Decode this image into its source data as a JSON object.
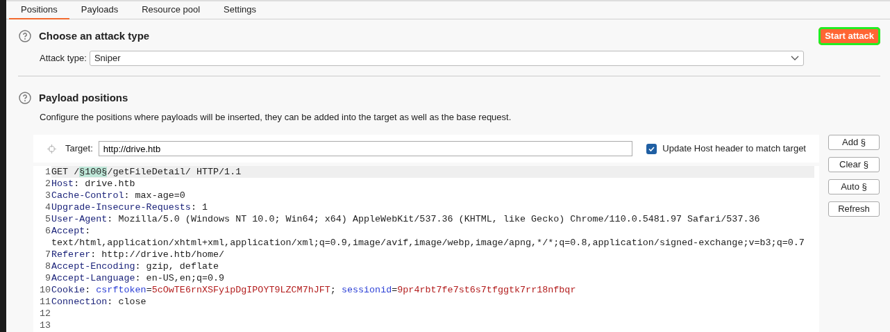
{
  "tabs": [
    {
      "label": "Positions",
      "selected": true
    },
    {
      "label": "Payloads",
      "selected": false
    },
    {
      "label": "Resource pool",
      "selected": false
    },
    {
      "label": "Settings",
      "selected": false
    }
  ],
  "attack_section": {
    "title": "Choose an attack type",
    "attack_type_label": "Attack type:",
    "attack_type_value": "Sniper"
  },
  "start_button": {
    "label": "Start attack",
    "highlighted": true
  },
  "positions_section": {
    "title": "Payload positions",
    "description": "Configure the positions where payloads will be inserted, they can be added into the target as well as the base request.",
    "target_label": "Target:",
    "target_value": "http://drive.htb",
    "update_host": {
      "label": "Update Host header to match target",
      "checked": true
    },
    "request_lines": [
      {
        "number": "1",
        "current": true,
        "segments": [
          {
            "kind": "plain",
            "text": "GET /"
          },
          {
            "kind": "marker",
            "text": "§100§"
          },
          {
            "kind": "plain",
            "text": "/getFileDetail/ HTTP/1.1"
          }
        ]
      },
      {
        "number": "2",
        "current": false,
        "segments": [
          {
            "kind": "header",
            "text": "Host"
          },
          {
            "kind": "plain",
            "text": ": drive.htb"
          }
        ]
      },
      {
        "number": "3",
        "current": false,
        "segments": [
          {
            "kind": "header",
            "text": "Cache-Control"
          },
          {
            "kind": "plain",
            "text": ": max-age=0"
          }
        ]
      },
      {
        "number": "4",
        "current": false,
        "segments": [
          {
            "kind": "header",
            "text": "Upgrade-Insecure-Requests"
          },
          {
            "kind": "plain",
            "text": ": 1"
          }
        ]
      },
      {
        "number": "5",
        "current": false,
        "segments": [
          {
            "kind": "header",
            "text": "User-Agent"
          },
          {
            "kind": "plain",
            "text": ": Mozilla/5.0 (Windows NT 10.0; Win64; x64) AppleWebKit/537.36 (KHTML, like Gecko) Chrome/110.0.5481.97 Safari/537.36"
          }
        ]
      },
      {
        "number": "6",
        "current": false,
        "segments": [
          {
            "kind": "header",
            "text": "Accept"
          },
          {
            "kind": "plain",
            "text": ":"
          }
        ]
      },
      {
        "current": false,
        "segments": [
          {
            "kind": "plain",
            "text": "text/html,application/xhtml+xml,application/xml;q=0.9,image/avif,image/webp,image/apng,*/*;q=0.8,application/signed-exchange;v=b3;q=0.7"
          }
        ]
      },
      {
        "number": "7",
        "current": false,
        "segments": [
          {
            "kind": "header",
            "text": "Referer"
          },
          {
            "kind": "plain",
            "text": ": http://drive.htb/home/"
          }
        ]
      },
      {
        "number": "8",
        "current": false,
        "segments": [
          {
            "kind": "header",
            "text": "Accept-Encoding"
          },
          {
            "kind": "plain",
            "text": ": gzip, deflate"
          }
        ]
      },
      {
        "number": "9",
        "current": false,
        "segments": [
          {
            "kind": "header",
            "text": "Accept-Language"
          },
          {
            "kind": "plain",
            "text": ": en-US,en;q=0.9"
          }
        ]
      },
      {
        "number": "10",
        "current": false,
        "segments": [
          {
            "kind": "header",
            "text": "Cookie"
          },
          {
            "kind": "plain",
            "text": ": "
          },
          {
            "kind": "key",
            "text": "csrftoken"
          },
          {
            "kind": "plain",
            "text": "="
          },
          {
            "kind": "value",
            "text": "5cOwTE6rnXSFyipDgIPOYT9LZCM7hJFT"
          },
          {
            "kind": "plain",
            "text": "; "
          },
          {
            "kind": "key",
            "text": "sessionid"
          },
          {
            "kind": "plain",
            "text": "="
          },
          {
            "kind": "value",
            "text": "9pr4rbt7fe7st6s7tfggtk7rr18nfbqr"
          }
        ]
      },
      {
        "number": "11",
        "current": false,
        "segments": [
          {
            "kind": "header",
            "text": "Connection"
          },
          {
            "kind": "plain",
            "text": ": close"
          }
        ]
      },
      {
        "number": "12",
        "current": false
      },
      {
        "number": "13",
        "current": false
      }
    ],
    "buttons": [
      "Add §",
      "Clear §",
      "Auto §",
      "Refresh"
    ]
  }
}
